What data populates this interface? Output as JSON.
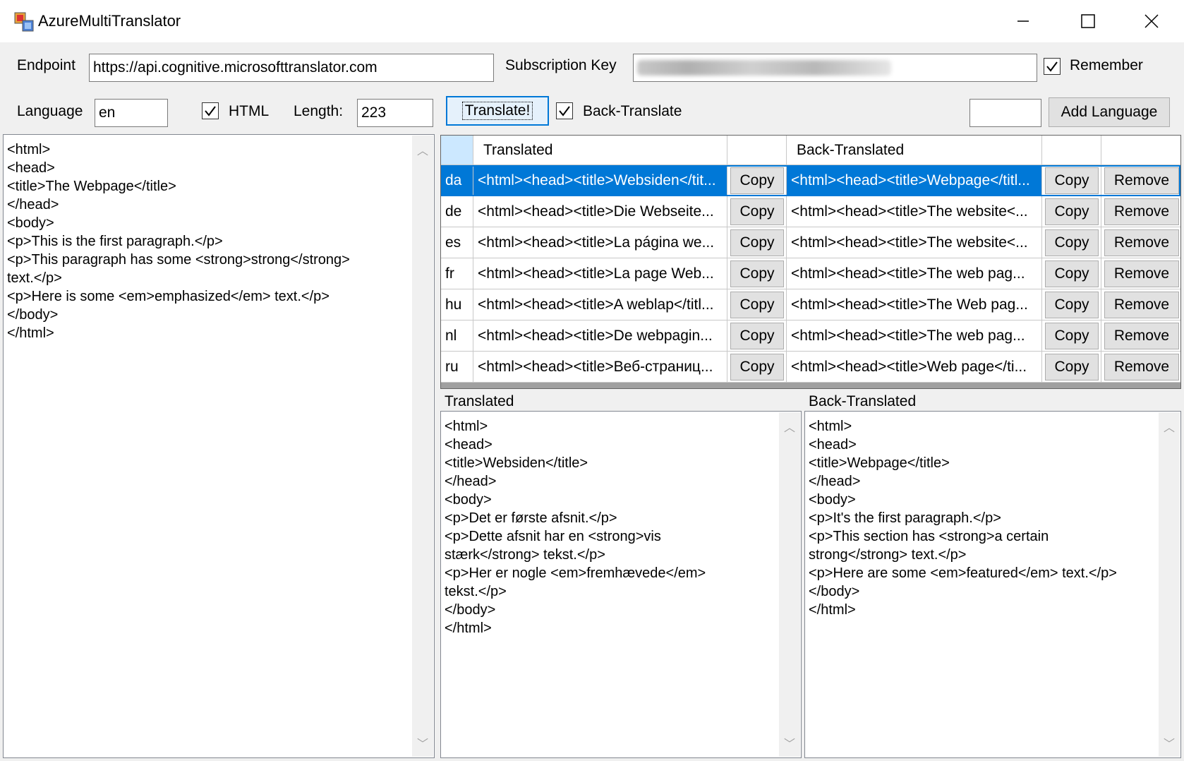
{
  "window": {
    "title": "AzureMultiTranslator"
  },
  "toolbar": {
    "endpoint_label": "Endpoint",
    "endpoint_value": "https://api.cognitive.microsofttranslator.com",
    "subscription_label": "Subscription Key",
    "remember_label": "Remember",
    "language_label": "Language",
    "language_value": "en",
    "html_label": "HTML",
    "length_label": "Length:",
    "length_value": "223",
    "translate_label": "Translate!",
    "backtranslate_label": "Back-Translate",
    "add_language_label": "Add Language"
  },
  "source_text": "<html>\n<head>\n<title>The Webpage</title>\n</head>\n<body>\n<p>This is the first paragraph.</p>\n<p>This paragraph has some <strong>strong</strong>\ntext.</p>\n<p>Here is some <em>emphasized</em> text.</p>\n</body>\n</html>",
  "grid": {
    "headers": {
      "translated": "Translated",
      "back_translated": "Back-Translated"
    },
    "copy_label": "Copy",
    "remove_label": "Remove",
    "rows": [
      {
        "lang": "da",
        "translated": "<html><head><title>Websiden</tit...",
        "back": "<html><head><title>Webpage</titl..."
      },
      {
        "lang": "de",
        "translated": "<html><head><title>Die Webseite...",
        "back": "<html><head><title>The website<..."
      },
      {
        "lang": "es",
        "translated": "<html><head><title>La página we...",
        "back": "<html><head><title>The website<..."
      },
      {
        "lang": "fr",
        "translated": "<html><head><title>La page Web...",
        "back": "<html><head><title>The web pag..."
      },
      {
        "lang": "hu",
        "translated": "<html><head><title>A weblap</titl...",
        "back": "<html><head><title>The Web pag..."
      },
      {
        "lang": "nl",
        "translated": "<html><head><title>De webpagin...",
        "back": "<html><head><title>The web pag..."
      },
      {
        "lang": "ru",
        "translated": "<html><head><title>Веб-страниц...",
        "back": "<html><head><title>Web page</ti..."
      }
    ]
  },
  "translated_panel": {
    "title": "Translated",
    "text": "<html>\n<head>\n<title>Websiden</title>\n</head>\n<body>\n<p>Det er første afsnit.</p>\n<p>Dette afsnit har en <strong>vis\nstærk</strong> tekst.</p>\n<p>Her er nogle <em>fremhævede</em>\ntekst.</p>\n</body>\n</html>"
  },
  "back_panel": {
    "title": "Back-Translated",
    "text": "<html>\n<head>\n<title>Webpage</title>\n</head>\n<body>\n<p>It's the first paragraph.</p>\n<p>This section has <strong>a certain\nstrong</strong> text.</p>\n<p>Here are some <em>featured</em> text.</p>\n</body>\n</html>"
  },
  "colors": {
    "selection": "#0078d7",
    "window_bg": "#f0f0f0"
  }
}
